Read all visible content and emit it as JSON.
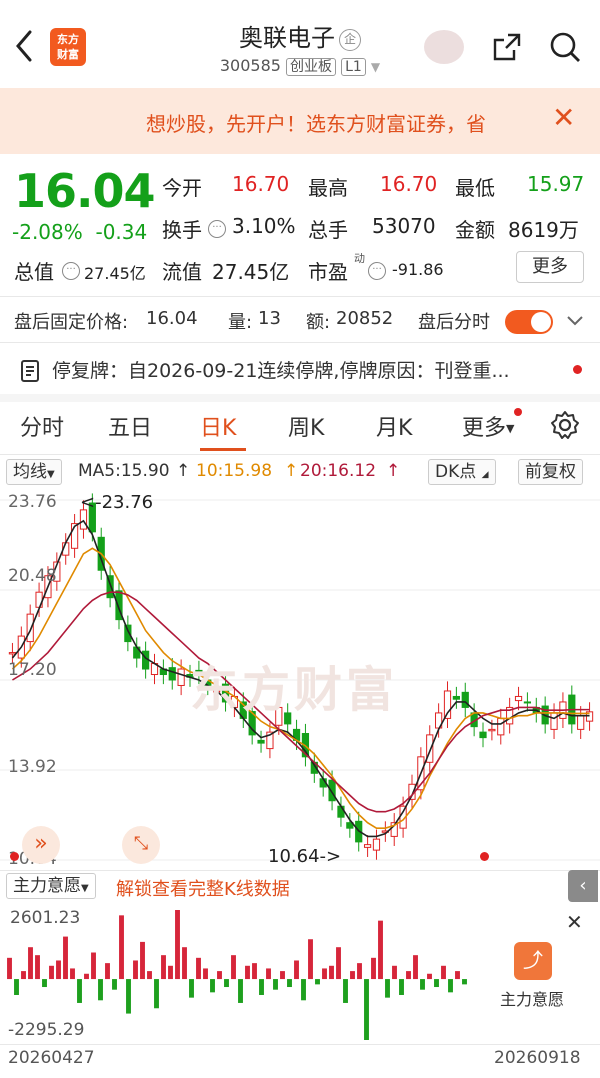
{
  "header": {
    "logo_text_1": "东方",
    "logo_text_2": "财富",
    "title": "奥联电子",
    "title_badge": "企",
    "code": "300585",
    "board": "创业板",
    "level": "L1"
  },
  "banner": {
    "text": "想炒股，先开户！选东方财富证券，省",
    "close": "✕"
  },
  "quote": {
    "price": "16.04",
    "pct": "-2.08%",
    "change": "-0.34",
    "open_label": "今开",
    "open": "16.70",
    "high_label": "最高",
    "high": "16.70",
    "low_label": "最低",
    "low": "15.97",
    "turnover_label": "换手",
    "turnover": "3.10%",
    "volume_label": "总手",
    "volume": "53070",
    "amount_label": "金额",
    "amount": "8619万",
    "mktcap_label": "总值",
    "mktcap": "27.45亿",
    "float_label": "流值",
    "float": "27.45亿",
    "pe_label": "市盈",
    "pe_sup": "动",
    "pe": "-91.86",
    "more": "更多"
  },
  "afterhours": {
    "label": "盘后固定价格:",
    "price": "16.04",
    "qty_label": "量:",
    "qty": "13",
    "amt_label": "额:",
    "amt": "20852",
    "realtime_label": "盘后分时"
  },
  "notice": {
    "text": "停复牌：自2026-09-21连续停牌,停牌原因：刊登重..."
  },
  "tabs": [
    "分时",
    "五日",
    "日K",
    "周K",
    "月K",
    "更多"
  ],
  "active_tab": 2,
  "ma_bar": {
    "line_select": "均线",
    "ma5": "MA5:15.90",
    "ma10": "10:15.98",
    "ma20": "20:16.12",
    "dk": "DK点",
    "adjust": "前复权"
  },
  "chart_data": {
    "type": "candlestick",
    "y_ticks": [
      "23.76",
      "20.48",
      "17.20",
      "13.92",
      "10.64"
    ],
    "ylim": [
      10.64,
      23.76
    ],
    "max_label": "<-23.76",
    "min_label": "10.64->",
    "watermark": "东方财富",
    "x_labels": [
      "20260427",
      "20260918"
    ],
    "close": [
      18.2,
      18.8,
      19.6,
      20.4,
      21.0,
      21.5,
      22.2,
      22.9,
      23.4,
      22.6,
      21.2,
      20.2,
      19.4,
      18.6,
      18.0,
      17.6,
      17.8,
      17.4,
      17.2,
      17.6,
      17.3,
      17.4,
      17.0,
      16.8,
      16.4,
      16.6,
      15.8,
      15.2,
      14.9,
      15.3,
      16.2,
      15.6,
      15.0,
      14.4,
      13.8,
      13.3,
      12.8,
      12.2,
      11.8,
      11.3,
      11.2,
      11.4,
      11.7,
      12.0,
      12.6,
      13.4,
      14.4,
      15.2,
      16.0,
      16.8,
      16.5,
      16.2,
      15.5,
      15.1,
      15.4,
      15.8,
      16.2,
      16.6,
      16.4,
      16.0,
      15.6,
      16.0,
      16.4,
      15.6,
      15.9,
      16.04
    ],
    "ma5": [
      18.0,
      18.4,
      19.0,
      19.8,
      20.6,
      21.4,
      22.2,
      22.8,
      23.0,
      22.5,
      21.6,
      20.7,
      19.8,
      19.0,
      18.4,
      18.0,
      17.8,
      17.6,
      17.5,
      17.4,
      17.3,
      17.2,
      17.0,
      16.8,
      16.5,
      16.2,
      15.8,
      15.4,
      15.1,
      15.2,
      15.4,
      15.3,
      15.0,
      14.6,
      14.1,
      13.6,
      13.1,
      12.6,
      12.1,
      11.7,
      11.5,
      11.5,
      11.6,
      11.9,
      12.4,
      13.0,
      13.8,
      14.6,
      15.4,
      16.0,
      16.4,
      16.4,
      16.1,
      15.8,
      15.6,
      15.6,
      15.8,
      16.0,
      16.1,
      16.1,
      15.9,
      15.8,
      16.0,
      15.9,
      15.9,
      15.9
    ],
    "ma10": [
      17.6,
      17.9,
      18.3,
      18.8,
      19.4,
      20.0,
      20.6,
      21.2,
      21.8,
      22.0,
      21.8,
      21.4,
      20.8,
      20.2,
      19.6,
      19.0,
      18.6,
      18.2,
      17.9,
      17.7,
      17.5,
      17.4,
      17.2,
      17.0,
      16.8,
      16.6,
      16.3,
      16.0,
      15.7,
      15.5,
      15.4,
      15.2,
      15.0,
      14.8,
      14.5,
      14.1,
      13.7,
      13.2,
      12.7,
      12.3,
      12.0,
      11.8,
      11.8,
      11.9,
      12.1,
      12.5,
      13.0,
      13.7,
      14.3,
      14.9,
      15.4,
      15.8,
      16.0,
      16.0,
      15.9,
      15.8,
      15.8,
      15.9,
      15.9,
      16.0,
      16.0,
      16.0,
      16.0,
      15.98,
      15.98,
      15.98
    ],
    "ma20": [
      17.2,
      17.4,
      17.6,
      17.9,
      18.2,
      18.6,
      19.0,
      19.4,
      19.8,
      20.1,
      20.3,
      20.4,
      20.4,
      20.3,
      20.1,
      19.8,
      19.5,
      19.2,
      18.9,
      18.6,
      18.3,
      18.0,
      17.8,
      17.5,
      17.2,
      16.9,
      16.6,
      16.3,
      16.0,
      15.7,
      15.4,
      15.1,
      14.8,
      14.5,
      14.2,
      13.9,
      13.6,
      13.3,
      13.0,
      12.7,
      12.5,
      12.4,
      12.4,
      12.5,
      12.7,
      13.0,
      13.4,
      13.8,
      14.3,
      14.8,
      15.2,
      15.5,
      15.7,
      15.9,
      16.0,
      16.1,
      16.1,
      16.2,
      16.2,
      16.2,
      16.1,
      16.1,
      16.1,
      16.12,
      16.12,
      16.12
    ]
  },
  "fund": {
    "select": "主力意愿",
    "unlock_text": "解锁查看完整K线数据",
    "max": "2601.23",
    "min": "-2295.29",
    "icon_label": "主力意愿",
    "values": [
      800,
      -600,
      300,
      1200,
      900,
      -300,
      500,
      700,
      1600,
      400,
      -900,
      200,
      1000,
      -800,
      600,
      -400,
      2400,
      -1300,
      700,
      1400,
      300,
      -1100,
      900,
      500,
      2601,
      1200,
      -700,
      800,
      400,
      -500,
      300,
      -300,
      900,
      -900,
      500,
      600,
      -600,
      400,
      -400,
      300,
      -300,
      700,
      -800,
      1500,
      -200,
      400,
      500,
      1200,
      -900,
      300,
      600,
      -2295,
      800,
      2200,
      -700,
      500,
      -600,
      300,
      900,
      -400,
      200,
      -300,
      500,
      -500,
      300,
      -200
    ]
  }
}
